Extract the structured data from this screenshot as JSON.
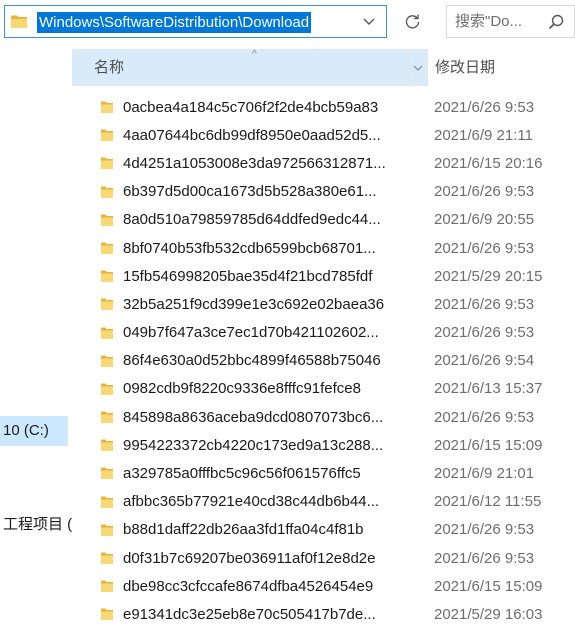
{
  "toolbar": {
    "address_path": "Windows\\SoftwareDistribution\\Download",
    "search_placeholder": "搜索\"Do...",
    "dropdown_icon": "chevron-down-icon",
    "refresh_icon": "refresh-icon"
  },
  "nav": {
    "items": [
      {
        "label": "10 (C:)",
        "selected": true
      },
      {
        "label": "工程项目 (",
        "selected": false
      }
    ]
  },
  "columns": {
    "name": "名称",
    "date": "修改日期"
  },
  "files": [
    {
      "name": "0acbea4a184c5c706f2f2de4bcb59a83",
      "date": "2021/6/26 9:53"
    },
    {
      "name": "4aa07644bc6db99df8950e0aad52d5...",
      "date": "2021/6/9 21:11"
    },
    {
      "name": "4d4251a1053008e3da972566312871...",
      "date": "2021/6/15 20:16"
    },
    {
      "name": "6b397d5d00ca1673d5b528a380e61...",
      "date": "2021/6/26 9:53"
    },
    {
      "name": "8a0d510a79859785d64ddfed9edc44...",
      "date": "2021/6/9 20:55"
    },
    {
      "name": "8bf0740b53fb532cdb6599bcb68701...",
      "date": "2021/6/26 9:53"
    },
    {
      "name": "15fb546998205bae35d4f21bcd785fdf",
      "date": "2021/5/29 20:15"
    },
    {
      "name": "32b5a251f9cd399e1e3c692e02baea36",
      "date": "2021/6/26 9:53"
    },
    {
      "name": "049b7f647a3ce7ec1d70b421102602...",
      "date": "2021/6/26 9:53"
    },
    {
      "name": "86f4e630a0d52bbc4899f46588b75046",
      "date": "2021/6/26 9:54"
    },
    {
      "name": "0982cdb9f8220c9336e8fffc91fefce8",
      "date": "2021/6/13 15:37"
    },
    {
      "name": "845898a8636aceba9dcd0807073bc6...",
      "date": "2021/6/26 9:53"
    },
    {
      "name": "9954223372cb4220c173ed9a13c288...",
      "date": "2021/6/15 15:09"
    },
    {
      "name": "a329785a0fffbc5c96c56f061576ffc5",
      "date": "2021/6/9 21:01"
    },
    {
      "name": "afbbc365b77921e40cd38c44db6b44...",
      "date": "2021/6/12 11:55"
    },
    {
      "name": "b88d1daff22db26aa3fd1ffa04c4f81b",
      "date": "2021/6/26 9:53"
    },
    {
      "name": "d0f31b7c69207be036911af0f12e8d2e",
      "date": "2021/6/26 9:53"
    },
    {
      "name": "dbe98cc3cfccafe8674dfba4526454e9",
      "date": "2021/6/15 15:09"
    },
    {
      "name": "e91341dc3e25eb8e70c505417b7de...",
      "date": "2021/5/29 16:03"
    }
  ],
  "colors": {
    "selection": "#0078d7",
    "folder": "#f8d775",
    "header_bg": "#d9ebf9",
    "nav_selected": "#cce8ff"
  }
}
